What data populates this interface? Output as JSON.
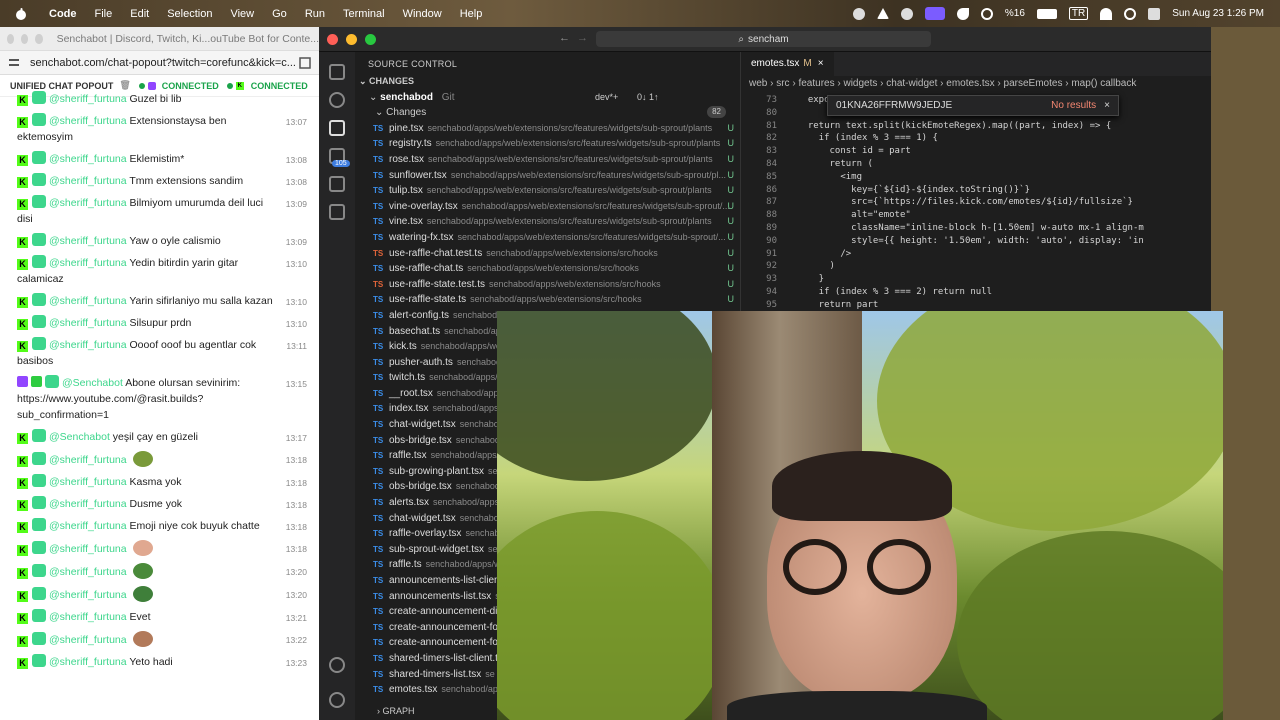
{
  "menubar": {
    "app": "Code",
    "items": [
      "File",
      "Edit",
      "Selection",
      "View",
      "Go",
      "Run",
      "Terminal",
      "Window",
      "Help"
    ],
    "battery": "%16",
    "input": "TR",
    "datetime": "Sun Aug 23  1:26 PM"
  },
  "browser": {
    "title": "Senchabot | Discord, Twitch, Ki...ouTube Bot for Conte...",
    "url": "senchabot.com/chat-popout?twitch=corefunc&kick=c..."
  },
  "chat": {
    "header": "UNIFIED CHAT POPOUT",
    "connected_label": "CONNECTED",
    "messages": [
      {
        "platform": "kick",
        "user": "@sheriff_furtuna",
        "text": "Guzel bi lib",
        "time": ""
      },
      {
        "platform": "kick",
        "user": "@sheriff_furtuna",
        "text": "Extensionstaysa ben ektemosyim",
        "time": "13:07"
      },
      {
        "platform": "kick",
        "user": "@sheriff_furtuna",
        "text": "Eklemistim*",
        "time": "13:08"
      },
      {
        "platform": "kick",
        "user": "@sheriff_furtuna",
        "text": "Tmm extensions sandim",
        "time": "13:08"
      },
      {
        "platform": "kick",
        "user": "@sheriff_furtuna",
        "text": "Bilmiyom umurumda deil luci disi",
        "time": "13:09"
      },
      {
        "platform": "kick",
        "user": "@sheriff_furtuna",
        "text": "Yaw o oyle calismio",
        "time": "13:09"
      },
      {
        "platform": "kick",
        "user": "@sheriff_furtuna",
        "text": "Yedin bitirdin yarin gitar calamicaz",
        "time": "13:10"
      },
      {
        "platform": "kick",
        "user": "@sheriff_furtuna",
        "text": "Yarin sifirlaniyo mu salla kazan",
        "time": "13:10"
      },
      {
        "platform": "kick",
        "user": "@sheriff_furtuna",
        "text": "Silsupur prdn",
        "time": "13:10"
      },
      {
        "platform": "kick",
        "user": "@sheriff_furtuna",
        "text": "Oooof ooof bu agentlar cok basibos",
        "time": "13:11"
      },
      {
        "platform": "twitch",
        "user": "@Senchabot",
        "text": "Abone olursan sevinirim: https://www.youtube.com/@rasit.builds?sub_confirmation=1",
        "time": "13:15"
      },
      {
        "platform": "kick",
        "user": "@Senchabot",
        "text": "yeşil çay en güzeli",
        "time": "13:17"
      },
      {
        "platform": "kick",
        "user": "@sheriff_furtuna",
        "text": "",
        "time": "13:18",
        "emote": "#7a9a3a"
      },
      {
        "platform": "kick",
        "user": "@sheriff_furtuna",
        "text": "Kasma yok",
        "time": "13:18"
      },
      {
        "platform": "kick",
        "user": "@sheriff_furtuna",
        "text": "Dusme yok",
        "time": "13:18"
      },
      {
        "platform": "kick",
        "user": "@sheriff_furtuna",
        "text": "Emoji niye cok buyuk chatte",
        "time": "13:18"
      },
      {
        "platform": "kick",
        "user": "@sheriff_furtuna",
        "text": "",
        "time": "13:18",
        "emote": "#e0a890"
      },
      {
        "platform": "kick",
        "user": "@sheriff_furtuna",
        "text": "",
        "time": "13:20",
        "emote": "#4a8a3a"
      },
      {
        "platform": "kick",
        "user": "@sheriff_furtuna",
        "text": "",
        "time": "13:20",
        "emote": "#3f7f3a"
      },
      {
        "platform": "kick",
        "user": "@sheriff_furtuna",
        "text": "Evet",
        "time": "13:21"
      },
      {
        "platform": "kick",
        "user": "@sheriff_furtuna",
        "text": "",
        "time": "13:22",
        "emote": "#b27a5a"
      },
      {
        "platform": "kick",
        "user": "@sheriff_furtuna",
        "text": "Yeto hadi",
        "time": "13:23"
      }
    ]
  },
  "vscode": {
    "search": "sencham",
    "scm_title": "SOURCE CONTROL",
    "changes_label": "CHANGES",
    "repo": "senchabod",
    "repo_type": "Git",
    "branch": "dev*+",
    "sync": "0↓ 1↑",
    "changes_group": "Changes",
    "changes_count": "82",
    "badge": "105",
    "graph_label": "GRAPH",
    "files": [
      {
        "type": "TS",
        "name": "pine.tsx",
        "path": "senchabod/apps/web/extensions/src/features/widgets/sub-sprout/plants",
        "status": "U"
      },
      {
        "type": "TS",
        "name": "registry.ts",
        "path": "senchabod/apps/web/extensions/src/features/widgets/sub-sprout/plants",
        "status": "U"
      },
      {
        "type": "TS",
        "name": "rose.tsx",
        "path": "senchabod/apps/web/extensions/src/features/widgets/sub-sprout/plants",
        "status": "U"
      },
      {
        "type": "TS",
        "name": "sunflower.tsx",
        "path": "senchabod/apps/web/extensions/src/features/widgets/sub-sprout/pl...",
        "status": "U"
      },
      {
        "type": "TS",
        "name": "tulip.tsx",
        "path": "senchabod/apps/web/extensions/src/features/widgets/sub-sprout/plants",
        "status": "U"
      },
      {
        "type": "TS",
        "name": "vine-overlay.tsx",
        "path": "senchabod/apps/web/extensions/src/features/widgets/sub-sprout/...",
        "status": "U"
      },
      {
        "type": "TS",
        "name": "vine.tsx",
        "path": "senchabod/apps/web/extensions/src/features/widgets/sub-sprout/plants",
        "status": "U"
      },
      {
        "type": "TS",
        "name": "watering-fx.tsx",
        "path": "senchabod/apps/web/extensions/src/features/widgets/sub-sprout/...",
        "status": "U"
      },
      {
        "type": "TS",
        "name": "use-raffle-chat.test.ts",
        "path": "senchabod/apps/web/extensions/src/hooks",
        "status": "U",
        "red": true
      },
      {
        "type": "TS",
        "name": "use-raffle-chat.ts",
        "path": "senchabod/apps/web/extensions/src/hooks",
        "status": "U"
      },
      {
        "type": "TS",
        "name": "use-raffle-state.test.ts",
        "path": "senchabod/apps/web/extensions/src/hooks",
        "status": "U",
        "red": true
      },
      {
        "type": "TS",
        "name": "use-raffle-state.ts",
        "path": "senchabod/apps/web/extensions/src/hooks",
        "status": "U"
      },
      {
        "type": "TS",
        "name": "alert-config.ts",
        "path": "senchabod/apps",
        "status": ""
      },
      {
        "type": "TS",
        "name": "basechat.ts",
        "path": "senchabod/apps",
        "status": ""
      },
      {
        "type": "TS",
        "name": "kick.ts",
        "path": "senchabod/apps/we",
        "status": ""
      },
      {
        "type": "TS",
        "name": "pusher-auth.ts",
        "path": "senchabod",
        "status": ""
      },
      {
        "type": "TS",
        "name": "twitch.ts",
        "path": "senchabod/apps/",
        "status": ""
      },
      {
        "type": "TS",
        "name": "__root.tsx",
        "path": "senchabod/apps",
        "status": ""
      },
      {
        "type": "TS",
        "name": "index.tsx",
        "path": "senchabod/apps/",
        "status": ""
      },
      {
        "type": "TS",
        "name": "chat-widget.tsx",
        "path": "senchabo",
        "status": ""
      },
      {
        "type": "TS",
        "name": "obs-bridge.tsx",
        "path": "senchabod",
        "status": ""
      },
      {
        "type": "TS",
        "name": "raffle.tsx",
        "path": "senchabod/apps/",
        "status": ""
      },
      {
        "type": "TS",
        "name": "sub-growing-plant.tsx",
        "path": "se",
        "status": ""
      },
      {
        "type": "TS",
        "name": "obs-bridge.tsx",
        "path": "senchabod",
        "status": ""
      },
      {
        "type": "TS",
        "name": "alerts.tsx",
        "path": "senchabod/apps/",
        "status": ""
      },
      {
        "type": "TS",
        "name": "chat-widget.tsx",
        "path": "senchabo",
        "status": ""
      },
      {
        "type": "TS",
        "name": "raffle-overlay.tsx",
        "path": "senchab",
        "status": ""
      },
      {
        "type": "TS",
        "name": "sub-sprout-widget.tsx",
        "path": "se",
        "status": ""
      },
      {
        "type": "TS",
        "name": "raffle.ts",
        "path": "senchabod/apps/w",
        "status": ""
      },
      {
        "type": "TS",
        "name": "announcements-list-client",
        "path": "",
        "status": ""
      },
      {
        "type": "TS",
        "name": "announcements-list.tsx",
        "path": "se",
        "status": ""
      },
      {
        "type": "TS",
        "name": "create-announcement-dia",
        "path": "",
        "status": ""
      },
      {
        "type": "TS",
        "name": "create-announcement-for",
        "path": "",
        "status": ""
      },
      {
        "type": "TS",
        "name": "create-announcement-for",
        "path": "",
        "status": ""
      },
      {
        "type": "TS",
        "name": "shared-timers-list-client.t",
        "path": "",
        "status": ""
      },
      {
        "type": "TS",
        "name": "shared-timers-list.tsx",
        "path": "se",
        "status": ""
      },
      {
        "type": "TS",
        "name": "emotes.tsx",
        "path": "senchabod/app",
        "status": ""
      }
    ],
    "tab": {
      "name": "emotes.tsx",
      "modified": "M"
    },
    "breadcrumb": "web  ›  src  ›  features  ›  widgets  ›  chat-widget  ›  emotes.tsx  ›  parseEmotes  ›  map() callback",
    "find": {
      "query": "01KNA26FFRMW9JEDJE",
      "result": "No results"
    },
    "code_lines": [
      {
        "n": "73",
        "t": "  export"
      },
      {
        "n": "80",
        "t": ""
      },
      {
        "n": "81",
        "t": "  return text.split(kickEmoteRegex).map((part, index) => {"
      },
      {
        "n": "82",
        "t": "    if (index % 3 === 1) {"
      },
      {
        "n": "83",
        "t": "      const id = part"
      },
      {
        "n": "84",
        "t": "      return ("
      },
      {
        "n": "85",
        "t": "        <img"
      },
      {
        "n": "86",
        "t": "          key={`${id}-${index.toString()}`}"
      },
      {
        "n": "87",
        "t": "          src={`https://files.kick.com/emotes/${id}/fullsize`}"
      },
      {
        "n": "88",
        "t": "          alt=\"emote\""
      },
      {
        "n": "89",
        "t": "          className=\"inline-block h-[1.50em] w-auto mx-1 align-m"
      },
      {
        "n": "90",
        "t": "          style={{ height: '1.50em', width: 'auto', display: 'in"
      },
      {
        "n": "91",
        "t": "        />"
      },
      {
        "n": "92",
        "t": "      )"
      },
      {
        "n": "93",
        "t": "    }"
      },
      {
        "n": "94",
        "t": "    if (index % 3 === 2) return null"
      },
      {
        "n": "95",
        "t": "    return part"
      }
    ]
  }
}
